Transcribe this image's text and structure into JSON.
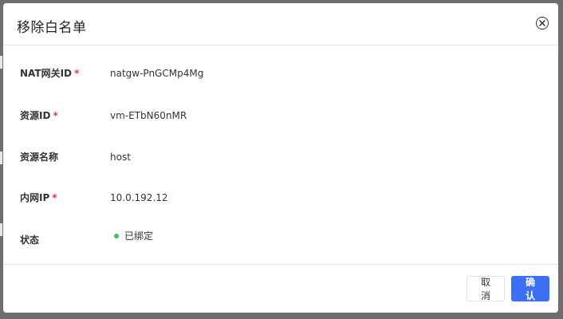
{
  "dialog": {
    "title": "移除白名单",
    "fields": [
      {
        "label": "NAT网关ID",
        "required": true,
        "value": "natgw-PnGCMp4Mg"
      },
      {
        "label": "资源ID",
        "required": true,
        "value": "vm-ETbN60nMR"
      },
      {
        "label": "资源名称",
        "required": false,
        "value": "host"
      },
      {
        "label": "内网IP",
        "required": true,
        "value": "10.0.192.12"
      },
      {
        "label": "状态",
        "required": false,
        "value": "已绑定"
      }
    ],
    "required_mark": "*",
    "cancel_label": "取消",
    "confirm_label": "确认"
  },
  "colors": {
    "primary": "#3c6ef6",
    "status_ok": "#3ec25a",
    "required": "#e0393e"
  },
  "icons": {
    "close": "close-circle-icon",
    "status": "status-dot-icon"
  }
}
